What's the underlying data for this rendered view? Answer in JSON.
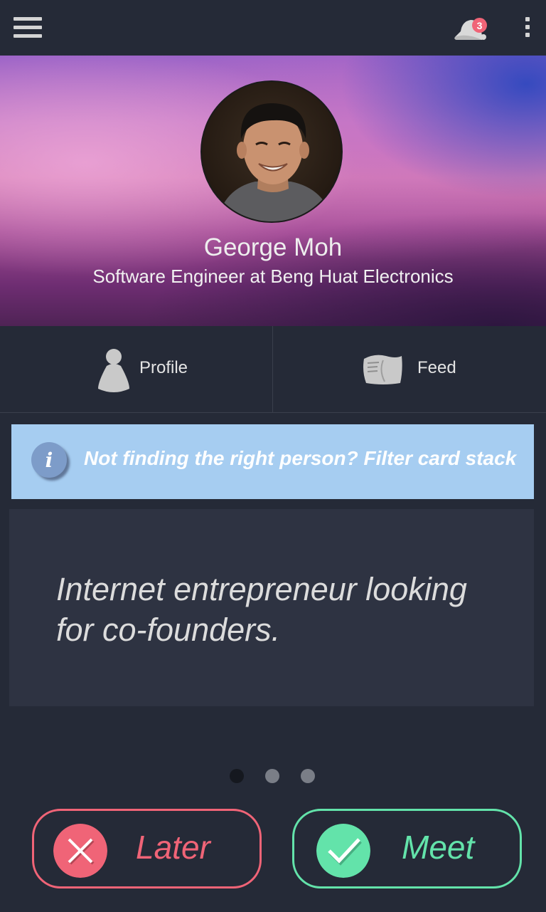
{
  "topbar": {
    "menu_icon": "hamburger-menu-icon",
    "notification_icon": "bell-icon",
    "notification_count": "3",
    "overflow_icon": "more-vertical-icon"
  },
  "profile": {
    "name": "George Moh",
    "title": "Software Engineer at Beng Huat Electronics"
  },
  "tabs": [
    {
      "label": "Profile",
      "icon": "person-icon"
    },
    {
      "label": "Feed",
      "icon": "news-feed-icon"
    }
  ],
  "banner": {
    "icon": "info-icon",
    "icon_glyph": "i",
    "text": "Not finding the right person? Filter card stack"
  },
  "card": {
    "text": "Internet entrepreneur looking for co-founders."
  },
  "pager": {
    "count": 3,
    "active_index": 0
  },
  "actions": {
    "later": {
      "label": "Later",
      "icon": "close-x-icon",
      "color": "#f06477"
    },
    "meet": {
      "label": "Meet",
      "icon": "check-icon",
      "color": "#63e3aa"
    }
  },
  "colors": {
    "background": "#252a37",
    "card": "#2e3342",
    "banner": "#a6cdf1",
    "info_icon": "#7d9cc9",
    "icon_gray": "#c9c9c9"
  }
}
